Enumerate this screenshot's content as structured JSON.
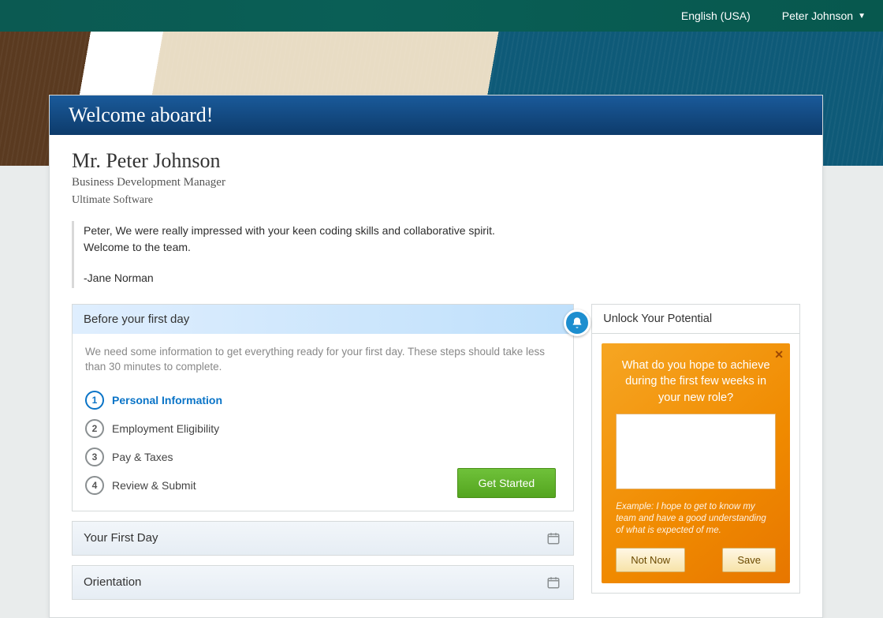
{
  "topbar": {
    "locale": "English (USA)",
    "user": "Peter Johnson"
  },
  "card": {
    "header": "Welcome aboard!",
    "name": "Mr. Peter Johnson",
    "title": "Business Development Manager",
    "company": "Ultimate Software",
    "message_line1": "Peter, We were really impressed with your keen coding skills and collaborative spirit.",
    "message_line2": "Welcome to the team.",
    "signature": "-Jane Norman"
  },
  "before": {
    "heading": "Before your first day",
    "desc": "We need some information to get everything ready for your first day. These steps should take less than 30 minutes to complete.",
    "steps": [
      {
        "n": "1",
        "label": "Personal Information",
        "active": true
      },
      {
        "n": "2",
        "label": "Employment Eligibility",
        "active": false
      },
      {
        "n": "3",
        "label": "Pay & Taxes",
        "active": false
      },
      {
        "n": "4",
        "label": "Review & Submit",
        "active": false
      }
    ],
    "cta": "Get Started"
  },
  "sections": {
    "first_day": "Your First Day",
    "orientation": "Orientation"
  },
  "goal": {
    "panel_title": "Unlock Your Potential",
    "question": "What do you hope to achieve during the first few weeks in your new role?",
    "hint": "Example: I hope to get to know my team and have a good understanding of what is expected of me.",
    "not_now": "Not Now",
    "save": "Save"
  }
}
